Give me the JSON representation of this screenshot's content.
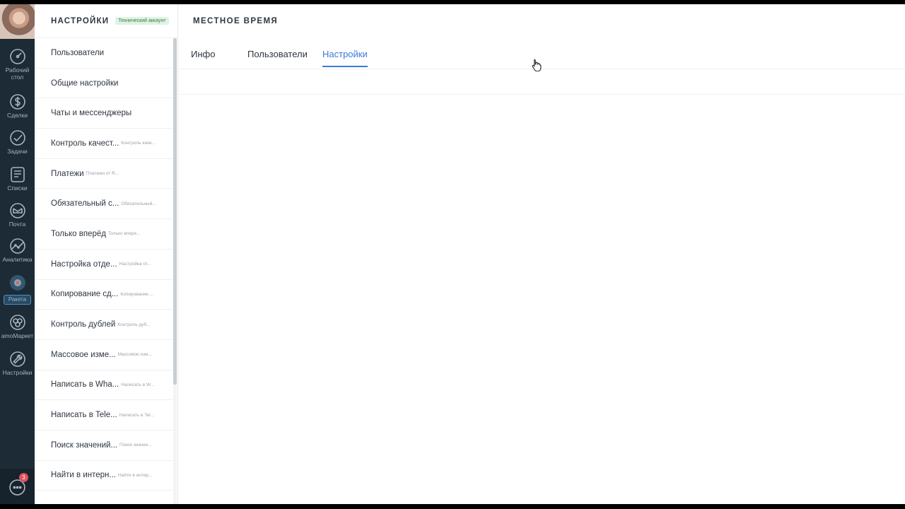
{
  "rail": {
    "items": [
      {
        "label": "Рабочий стол",
        "icon": "dashboard-icon"
      },
      {
        "label": "Сделки",
        "icon": "dollar-icon"
      },
      {
        "label": "Задачи",
        "icon": "check-icon"
      },
      {
        "label": "Списки",
        "icon": "list-icon"
      },
      {
        "label": "Почта",
        "icon": "mail-icon"
      },
      {
        "label": "Аналитика",
        "icon": "analytics-icon"
      },
      {
        "label": "Ракета",
        "icon": "rocket-icon"
      },
      {
        "label": "amoМаркет",
        "icon": "market-icon"
      },
      {
        "label": "Настройки",
        "icon": "wrench-icon"
      }
    ],
    "chat_badge": "3"
  },
  "side": {
    "title": "НАСТРОЙКИ",
    "badge": "Технический аккаунт",
    "items": [
      {
        "label": "Пользователи",
        "desc": ""
      },
      {
        "label": "Общие настройки",
        "desc": ""
      },
      {
        "label": "Чаты и мессенджеры",
        "desc": ""
      },
      {
        "label": "Контроль качест...",
        "desc": "Контроль каче..."
      },
      {
        "label": "Платежи",
        "desc": "Платежи от R..."
      },
      {
        "label": "Обязательный с...",
        "desc": "Обязательный..."
      },
      {
        "label": "Только вперёд",
        "desc": "Только впере..."
      },
      {
        "label": "Настройка отде...",
        "desc": "Настройка от..."
      },
      {
        "label": "Копирование сд...",
        "desc": "Копирование ..."
      },
      {
        "label": "Контроль дублей",
        "desc": "Контроль дуб..."
      },
      {
        "label": "Массовое изме...",
        "desc": "Массовое изм..."
      },
      {
        "label": "Написать в Wha...",
        "desc": "Написать в W..."
      },
      {
        "label": "Написать в Tele...",
        "desc": "Написать в Tel..."
      },
      {
        "label": "Поиск значений...",
        "desc": "Поиск значен..."
      },
      {
        "label": "Найти в интерн...",
        "desc": "Найти в интер..."
      }
    ]
  },
  "main": {
    "title": "МЕСТНОЕ ВРЕМЯ",
    "tabs": [
      {
        "label": "Инфо",
        "active": false
      },
      {
        "label": "Пользователи",
        "active": false
      },
      {
        "label": "Настройки",
        "active": true
      }
    ]
  },
  "colors": {
    "rail_bg": "#1c2b36",
    "accent": "#3a7bd5",
    "badge_bg": "#dff3e3",
    "notification": "#e0515c"
  }
}
